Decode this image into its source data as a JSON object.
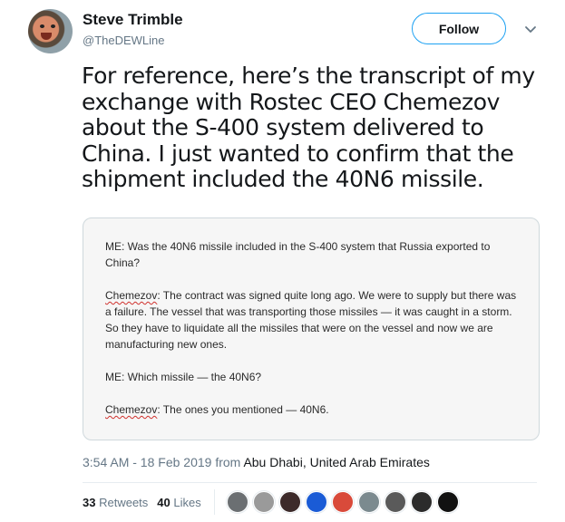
{
  "author": {
    "name": "Steve Trimble",
    "handle": "@TheDEWLine"
  },
  "follow_label": "Follow",
  "tweet": {
    "text": "For reference, here’s the transcript of my exchange with Rostec CEO Chemezov about the S-400 system delivered to China. I just wanted to confirm that the shipment included the 40N6 missile."
  },
  "card": {
    "p1": "ME: Was the 40N6 missile included in the S-400 system that Russia exported to China?",
    "p2_speaker": "Chemezov",
    "p2_text": ": The contract was signed quite long ago. We were to supply but there was a failure. The vessel that was transporting those missiles — it was caught in a storm. So they have to liquidate all the missiles that were on the vessel and now we are manufacturing new ones.",
    "p3": "ME: Which missile — the 40N6?",
    "p4_speaker": "Chemezov",
    "p4_text": ": The ones you mentioned — 40N6."
  },
  "meta": {
    "time": "3:54 AM - 18 Feb 2019 from ",
    "location": "Abu Dhabi, United Arab Emirates"
  },
  "stats": {
    "retweets_count": "33",
    "retweets_label": "Retweets",
    "likes_count": "40",
    "likes_label": "Likes"
  },
  "likers": [
    {
      "name": "liker-avatar-1",
      "color": "#6b6f72"
    },
    {
      "name": "liker-avatar-2",
      "color": "#9a9a9a"
    },
    {
      "name": "liker-avatar-3",
      "color": "#3c2a2a"
    },
    {
      "name": "liker-avatar-4",
      "color": "#1a5bd6"
    },
    {
      "name": "liker-avatar-5",
      "color": "#d94a3a"
    },
    {
      "name": "liker-avatar-6",
      "color": "#7b8a8f"
    },
    {
      "name": "liker-avatar-7",
      "color": "#5a5a5a"
    },
    {
      "name": "liker-avatar-8",
      "color": "#2b2b2b"
    },
    {
      "name": "liker-avatar-9",
      "color": "#111111"
    }
  ]
}
